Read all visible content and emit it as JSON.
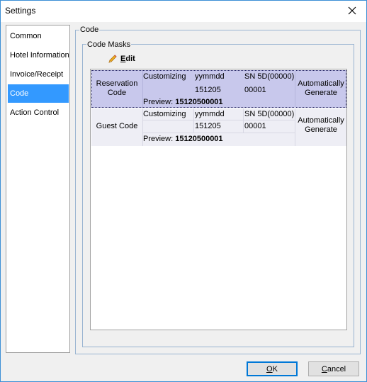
{
  "window": {
    "title": "Settings"
  },
  "nav": {
    "items": [
      {
        "label": "Common",
        "selected": false
      },
      {
        "label": "Hotel Information",
        "selected": false
      },
      {
        "label": "Invoice/Receipt",
        "selected": false
      },
      {
        "label": "Code",
        "selected": true
      },
      {
        "label": "Action Control",
        "selected": false
      }
    ]
  },
  "panel": {
    "group_title": "Code",
    "masks_title": "Code Masks",
    "edit": {
      "prefix": "",
      "mnemonic": "E",
      "rest": "dit"
    }
  },
  "rows": [
    {
      "name": "Reservation Code",
      "name_line1": "Reservation",
      "name_line2": "Code",
      "customizing": "Customizing",
      "date_format": "yymmdd",
      "date_value": "151205",
      "sn_format": "SN 5D(00000)",
      "sn_value": "00001",
      "generate_line1": "Automatically",
      "generate_line2": "Generate",
      "preview_label": "Preview:",
      "preview_value": "15120500001",
      "selected": true
    },
    {
      "name": "Guest Code",
      "customizing": "Customizing",
      "date_format": "yymmdd",
      "date_value": "151205",
      "sn_format": "SN 5D(00000)",
      "sn_value": "00001",
      "generate_line1": "Automatically",
      "generate_line2": "Generate",
      "preview_label": "Preview:",
      "preview_value": "15120500001",
      "selected": false
    }
  ],
  "buttons": {
    "ok": {
      "mnemonic": "O",
      "rest": "K"
    },
    "cancel": {
      "mnemonic": "C",
      "rest": "ancel"
    }
  },
  "colors": {
    "selection": "#3399ff",
    "row_selected": "#c8c8ec",
    "row_normal": "#eeeef5"
  },
  "icons": {
    "close": "close-icon",
    "edit": "pencil-icon"
  }
}
